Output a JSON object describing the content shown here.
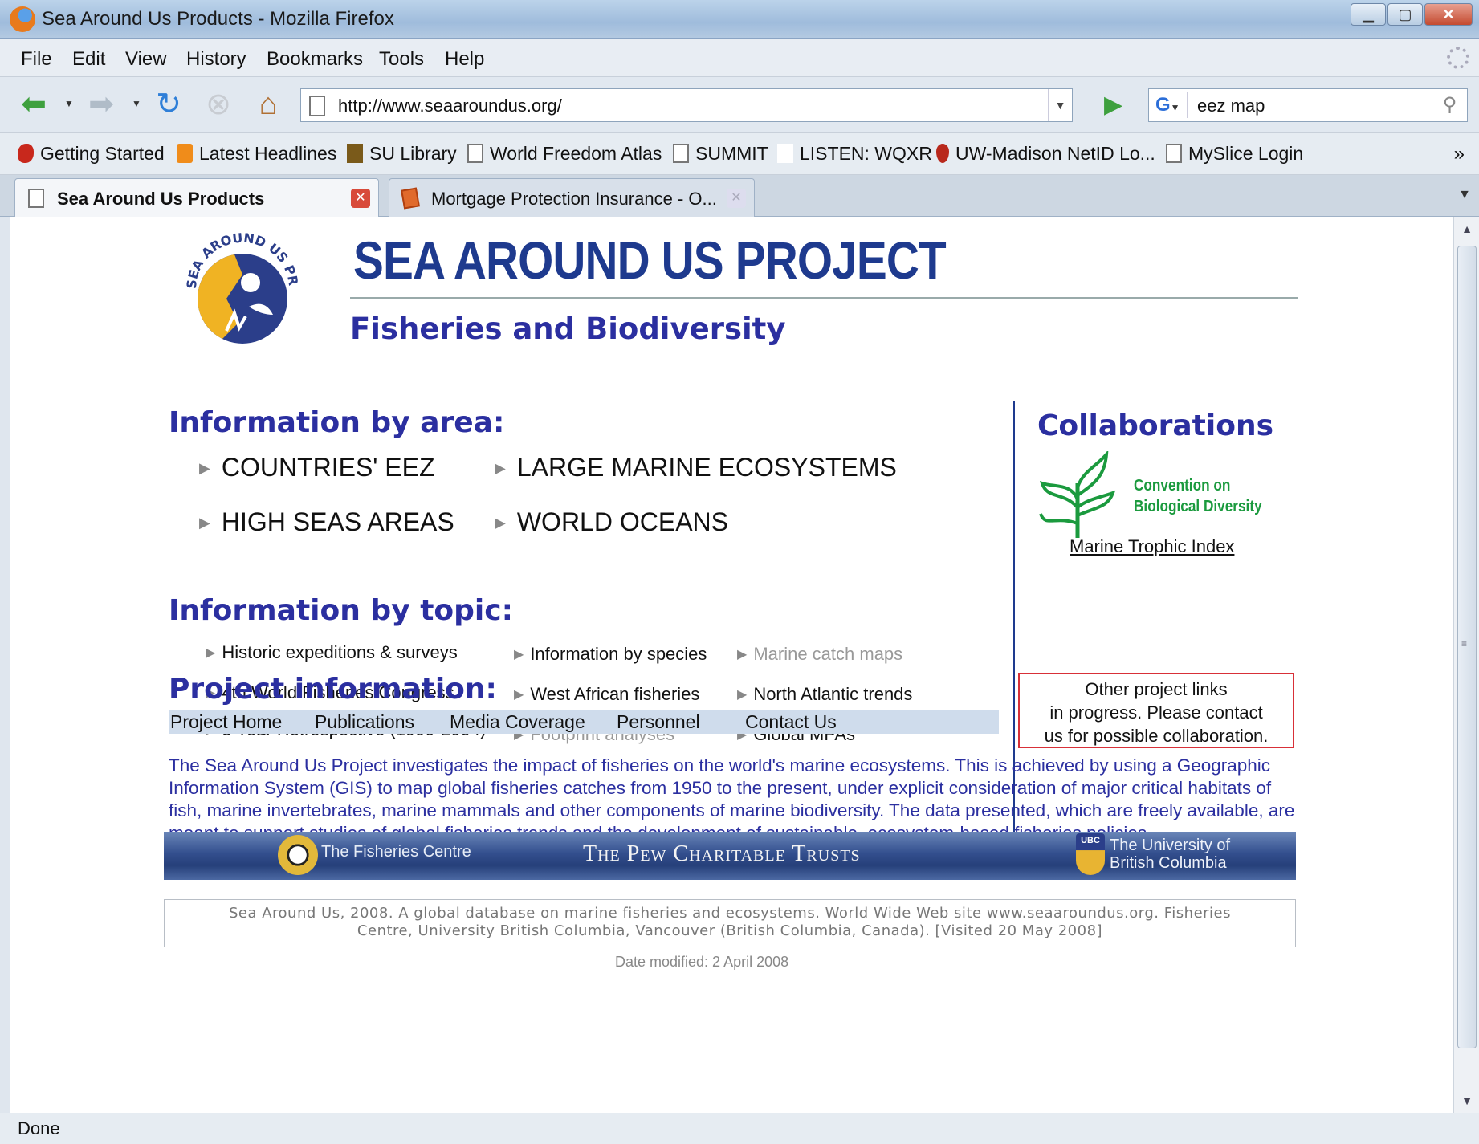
{
  "window": {
    "title": "Sea Around Us Products - Mozilla Firefox",
    "controls": [
      "minimize",
      "maximize",
      "close"
    ]
  },
  "menu": [
    "File",
    "Edit",
    "View",
    "History",
    "Bookmarks",
    "Tools",
    "Help"
  ],
  "navigation": {
    "url": "http://www.seaaroundus.org/",
    "search_engine": "G",
    "search_query": "eez map"
  },
  "bookmarks": [
    {
      "label": "Getting Started",
      "icon": "red-icon"
    },
    {
      "label": "Latest Headlines",
      "icon": "rss-icon"
    },
    {
      "label": "SU Library",
      "icon": "library-icon"
    },
    {
      "label": "World Freedom Atlas",
      "icon": "page-icon"
    },
    {
      "label": "SUMMIT",
      "icon": "page-icon"
    },
    {
      "label": "LISTEN: WQXR",
      "icon": "blank-icon"
    },
    {
      "label": "UW-Madison NetID Lo...",
      "icon": "shield-icon"
    },
    {
      "label": "MySlice Login",
      "icon": "page-icon"
    }
  ],
  "bookmarks_more": "»",
  "tabs": [
    {
      "label": "Sea Around Us Products",
      "active": true
    },
    {
      "label": "Mortgage Protection Insurance - O...",
      "active": false
    }
  ],
  "page": {
    "logo_text": "SEA AROUND US PROJECT",
    "title": "SEA AROUND US PROJECT",
    "subtitle": "Fisheries and Biodiversity",
    "area": {
      "heading": "Information by area:",
      "links": [
        "COUNTRIES' EEZ",
        "LARGE MARINE ECOSYSTEMS",
        "HIGH SEAS AREAS",
        "WORLD OCEANS"
      ]
    },
    "topic": {
      "heading": "Information by topic:",
      "links": [
        {
          "label": "Historic expeditions & surveys",
          "enabled": true
        },
        {
          "label": "Information by species",
          "enabled": true
        },
        {
          "label": "Marine catch maps",
          "enabled": false
        },
        {
          "label": "4th World Fisheries Congress",
          "enabled": true
        },
        {
          "label": "West African fisheries",
          "enabled": true
        },
        {
          "label": "North Atlantic trends",
          "enabled": true
        },
        {
          "label": "5 Year Retrospective (1999-2004)",
          "enabled": true
        },
        {
          "label": "Footprint analyses",
          "enabled": false
        },
        {
          "label": "Global MPAs",
          "enabled": true
        }
      ]
    },
    "project": {
      "heading": "Project information:",
      "links": [
        "Project Home",
        "Publications",
        "Media Coverage",
        "Personnel",
        "Contact Us"
      ]
    },
    "collaborations": {
      "heading": "Collaborations",
      "cbd_line1": "Convention on",
      "cbd_line2": "Biological Diversity",
      "link": "Marine Trophic Index",
      "other_line1": "Other project links",
      "other_line2": "in progress. Please contact",
      "other_line3": "us for possible collaboration."
    },
    "description": "The Sea Around Us Project investigates the impact of fisheries on the world's marine ecosystems. This is achieved by using a Geographic Information System (GIS) to map global fisheries catches from 1950 to the present, under explicit consideration of major critical habitats of fish, marine invertebrates, marine mammals and other components of marine biodiversity. The data presented, which are freely available, are meant to support studies of global fisheries trends and the development of sustainable, ecosystem-based fisheries policies.",
    "banner": {
      "fisheries_centre": "The Fisheries Centre",
      "pew": "The Pew Charitable Trusts",
      "ubc_mark": "UBC",
      "ubc_line1": "The University of",
      "ubc_line2": "British Columbia"
    },
    "citation_line1": "Sea Around Us, 2008. A global database on marine fisheries and ecosystems. World Wide Web site www.seaaroundus.org. Fisheries",
    "citation_line2": "Centre, University British Columbia, Vancouver (British Columbia, Canada). [Visited 20 May 2008]",
    "updated": "Date modified: 2 April 2008"
  },
  "status": "Done"
}
